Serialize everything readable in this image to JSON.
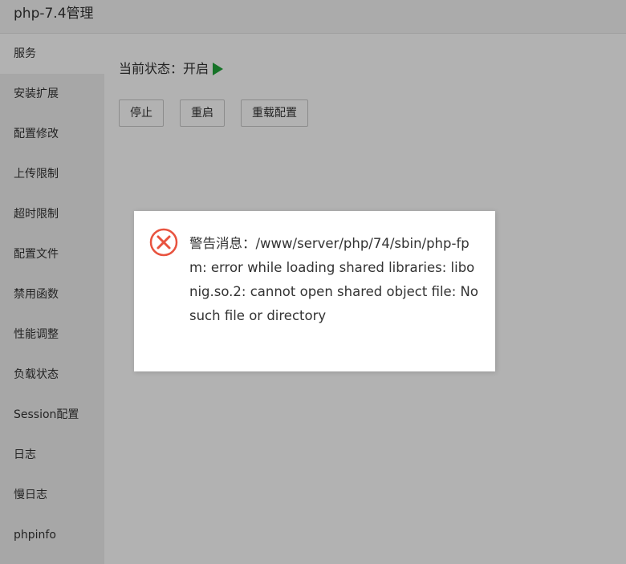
{
  "window": {
    "title": "php-7.4管理"
  },
  "sidebar": {
    "items": [
      {
        "label": "服务",
        "active": true
      },
      {
        "label": "安装扩展"
      },
      {
        "label": "配置修改"
      },
      {
        "label": "上传限制"
      },
      {
        "label": "超时限制"
      },
      {
        "label": "配置文件"
      },
      {
        "label": "禁用函数"
      },
      {
        "label": "性能调整"
      },
      {
        "label": "负载状态"
      },
      {
        "label": "Session配置"
      },
      {
        "label": "日志"
      },
      {
        "label": "慢日志"
      },
      {
        "label": "phpinfo"
      }
    ]
  },
  "main": {
    "status_text": "当前状态：开启",
    "status_icon": "play-icon",
    "status_color": "#20a53a",
    "buttons": {
      "stop": "停止",
      "restart": "重启",
      "reload": "重载配置"
    }
  },
  "dialog": {
    "icon": "error-icon",
    "icon_color": "#e8533f",
    "message": "警告消息：/www/server/php/74/sbin/php-fpm: error while loading shared libraries: libonig.so.2: cannot open shared object file: No such file or directory"
  }
}
